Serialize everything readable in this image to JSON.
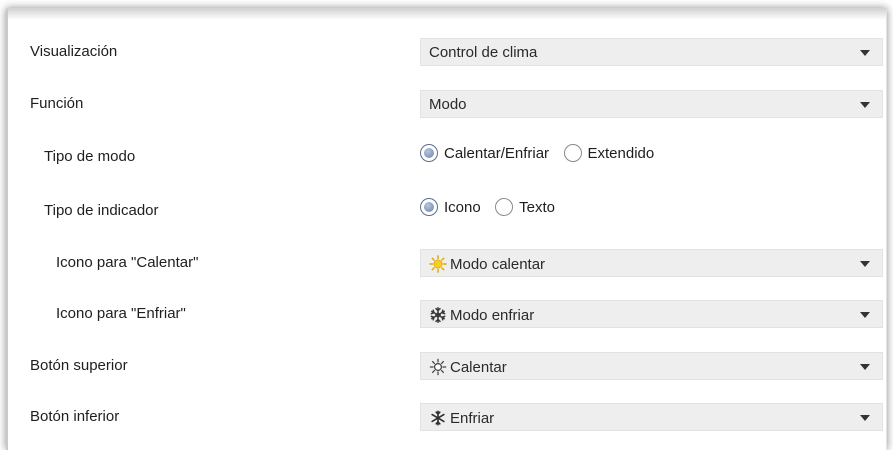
{
  "settings": {
    "visualizacion": {
      "label": "Visualización",
      "value": "Control de clima"
    },
    "funcion": {
      "label": "Función",
      "value": "Modo"
    },
    "tipo_modo": {
      "label": "Tipo de modo",
      "options": [
        "Calentar/Enfriar",
        "Extendido"
      ],
      "selected": "Calentar/Enfriar"
    },
    "tipo_indicador": {
      "label": "Tipo de indicador",
      "options": [
        "Icono",
        "Texto"
      ],
      "selected": "Icono"
    },
    "icono_calentar": {
      "label": "Icono para \"Calentar\"",
      "value": "Modo calentar",
      "icon": "sun-icon"
    },
    "icono_enfriar": {
      "label": "Icono para \"Enfriar\"",
      "value": "Modo enfriar",
      "icon": "snowflake-icon"
    },
    "boton_superior": {
      "label": "Botón superior",
      "value": "Calentar",
      "icon": "sun-outline-icon"
    },
    "boton_inferior": {
      "label": "Botón inferior",
      "value": "Enfriar",
      "icon": "snowflake-icon"
    }
  },
  "colors": {
    "sun": "#f2c51a",
    "icon_dark": "#3a3a3a",
    "radio_selected": "#6b84aa",
    "dropdown_bg": "#eeeeee"
  }
}
